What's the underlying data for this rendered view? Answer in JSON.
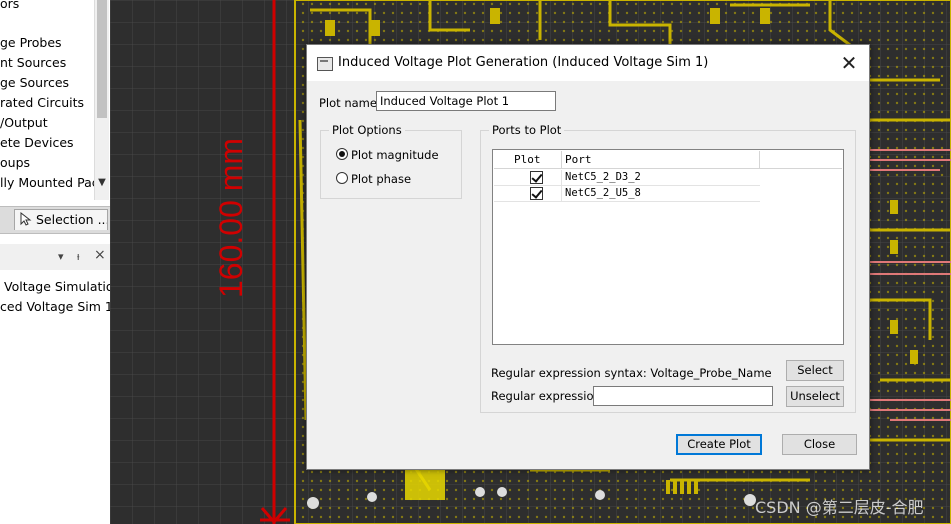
{
  "left_panel": {
    "tree_items": [
      "ors",
      "ge Probes",
      "nt Sources",
      "ge Sources",
      "rated Circuits",
      "/Output",
      "ete Devices",
      "oups",
      "lly Mounted Pac"
    ],
    "tab_label": "Selection ...",
    "sim_items": [
      "Voltage Simulation",
      "ced Voltage Sim 1"
    ],
    "panel_controls": {
      "dropdown": "▾",
      "pin": "ᵼ",
      "close": "×"
    }
  },
  "canvas": {
    "dimension_label": "160.00 mm",
    "watermark": "CSDN @第二层皮-合肥",
    "colors": {
      "grid": "#4a4a4a",
      "trace_yellow": "#c9b400",
      "trace_pink": "#e07878",
      "dimension_red": "#d00000"
    }
  },
  "dialog": {
    "title": "Induced Voltage Plot Generation (Induced Voltage Sim 1)",
    "plot_name_label": "Plot name:",
    "plot_name_value": "Induced Voltage Plot 1",
    "plot_options": {
      "legend": "Plot Options",
      "magnitude_label": "Plot magnitude",
      "phase_label": "Plot phase",
      "selected": "magnitude"
    },
    "ports_to_plot": {
      "legend": "Ports to Plot",
      "columns": [
        "Plot",
        "Port"
      ],
      "rows": [
        {
          "checked": true,
          "port": "NetC5_2_D3_2"
        },
        {
          "checked": true,
          "port": "NetC5_2_U5_8"
        }
      ]
    },
    "regex_syntax_label": "Regular expression syntax: Voltage_Probe_Name",
    "regex_label": "Regular expression:",
    "regex_value": "",
    "select_button": "Select",
    "unselect_button": "Unselect",
    "create_plot_button": "Create Plot",
    "close_button": "Close"
  }
}
